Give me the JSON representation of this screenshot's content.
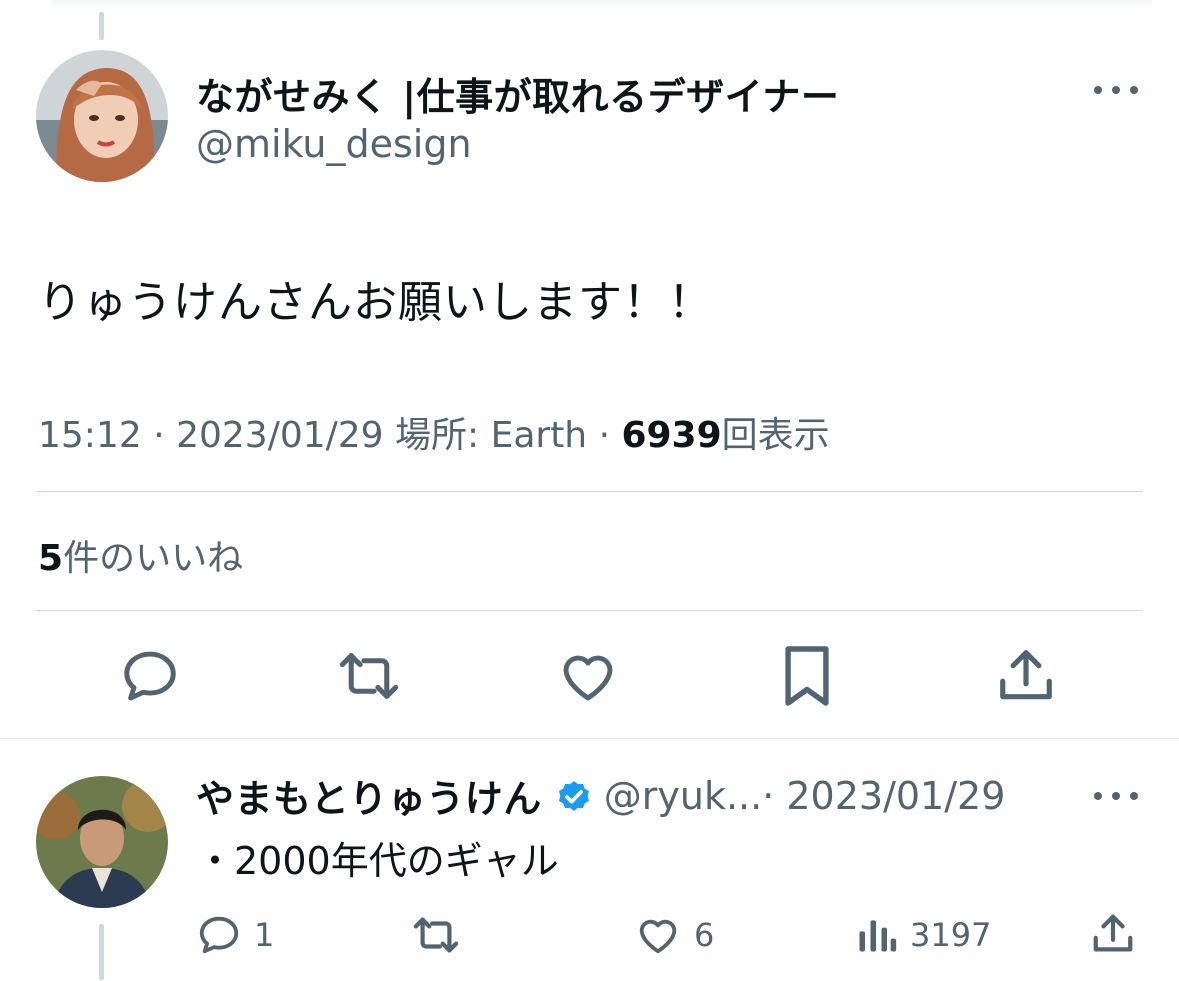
{
  "tweet": {
    "author_name": "ながせみく |仕事が取れるデザイナー",
    "author_handle": "@miku_design",
    "text": "りゅうけんさんお願いします！！",
    "time": "15:12 · 2023/01/29 場所: Earth · ",
    "views_count": "6939",
    "views_label": "回表示",
    "likes_count": "5",
    "likes_label": "件のいいね",
    "icons": [
      "reply-icon",
      "retweet-icon",
      "like-icon",
      "bookmark-icon",
      "share-icon",
      "more-icon"
    ]
  },
  "reply": {
    "author_name": "やまもとりゅうけん",
    "author_handle": "@ryuk...",
    "date": " · 2023/01/29",
    "text": "・2000年代のギャル",
    "reply_count": "1",
    "like_count": "6",
    "view_count": "3197",
    "verified": true
  },
  "colors": {
    "text": "#0f1419",
    "secondary": "#536471",
    "divider": "#cfd9de",
    "verified": "#1d9bf0"
  }
}
